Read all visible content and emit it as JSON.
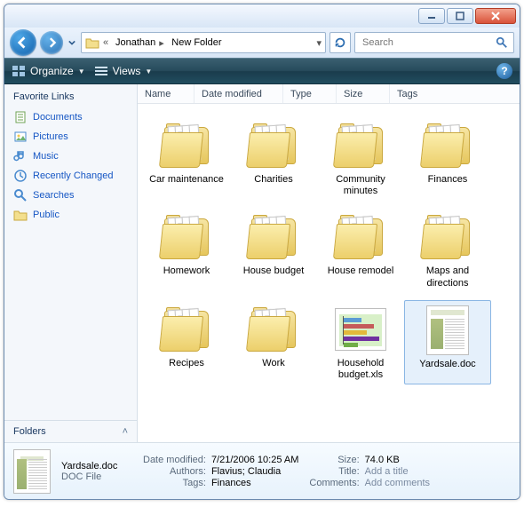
{
  "breadcrumb": {
    "seg1": "Jonathan",
    "seg2": "New Folder"
  },
  "search": {
    "placeholder": "Search"
  },
  "toolbar": {
    "organize": "Organize",
    "views": "Views"
  },
  "sidebar": {
    "header": "Favorite Links",
    "links": [
      {
        "label": "Documents"
      },
      {
        "label": "Pictures"
      },
      {
        "label": "Music"
      },
      {
        "label": "Recently Changed"
      },
      {
        "label": "Searches"
      },
      {
        "label": "Public"
      }
    ],
    "folders_header": "Folders"
  },
  "columns": {
    "name": "Name",
    "date": "Date modified",
    "type": "Type",
    "size": "Size",
    "tags": "Tags"
  },
  "items": [
    {
      "label": "Car maintenance",
      "kind": "folder"
    },
    {
      "label": "Charities",
      "kind": "folder"
    },
    {
      "label": "Community minutes",
      "kind": "folder"
    },
    {
      "label": "Finances",
      "kind": "folder"
    },
    {
      "label": "Homework",
      "kind": "folder"
    },
    {
      "label": "House budget",
      "kind": "folder"
    },
    {
      "label": "House remodel",
      "kind": "folder"
    },
    {
      "label": "Maps and directions",
      "kind": "folder"
    },
    {
      "label": "Recipes",
      "kind": "folder"
    },
    {
      "label": "Work",
      "kind": "folder"
    },
    {
      "label": "Household budget.xls",
      "kind": "xls"
    },
    {
      "label": "Yardsale.doc",
      "kind": "doc",
      "selected": true
    }
  ],
  "details": {
    "filename": "Yardsale.doc",
    "filetype": "DOC File",
    "labels": {
      "date_modified": "Date modified:",
      "authors": "Authors:",
      "tags": "Tags:",
      "size": "Size:",
      "title": "Title:",
      "comments": "Comments:"
    },
    "values": {
      "date_modified": "7/21/2006 10:25 AM",
      "authors": "Flavius; Claudia",
      "tags": "Finances",
      "size": "74.0 KB",
      "title": "Add a title",
      "comments": "Add comments"
    }
  }
}
